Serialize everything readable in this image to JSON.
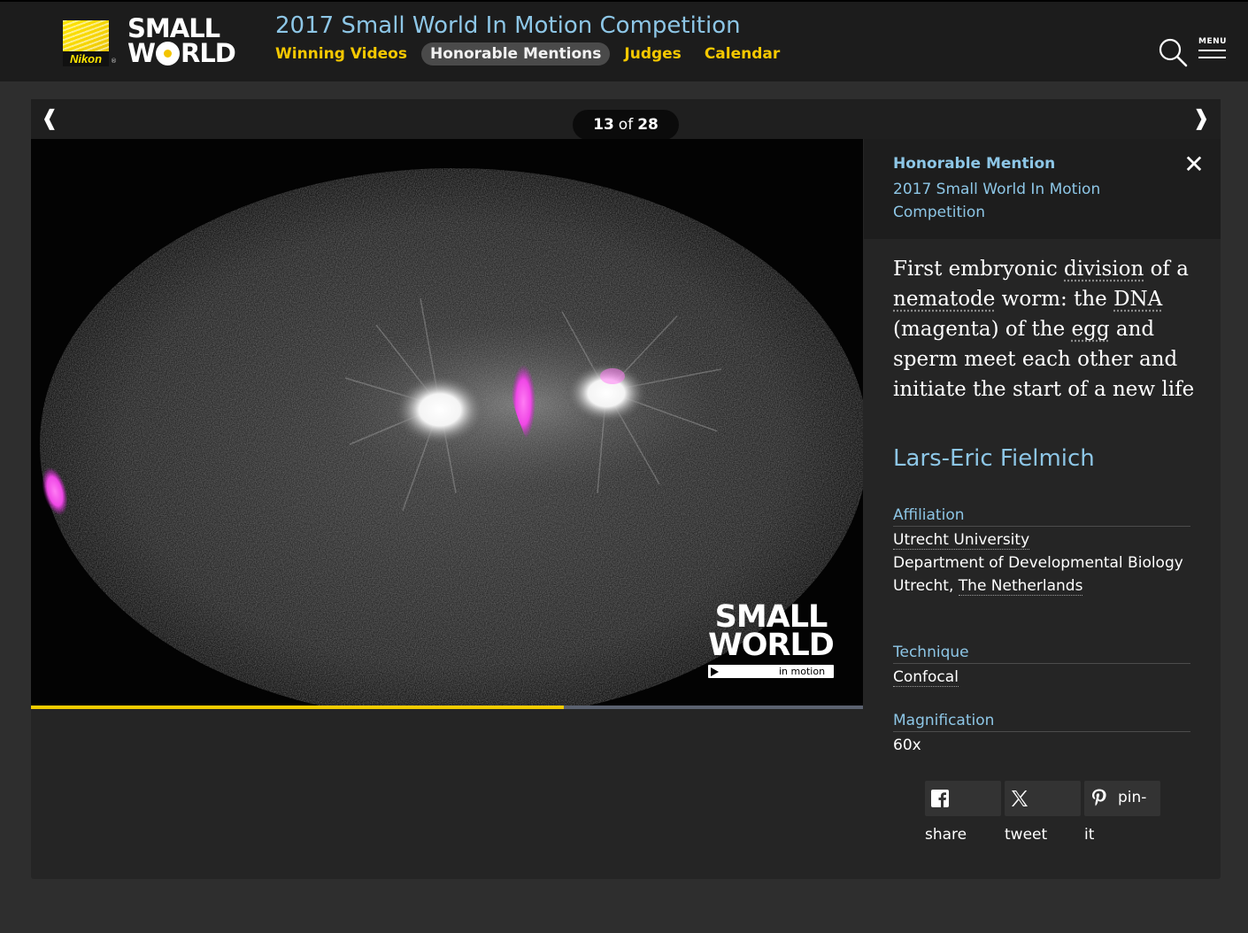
{
  "brand": {
    "nikon_text": "Nikon",
    "registered": "®",
    "small_world_line1": "SMALL",
    "small_world_line2_pre": "W",
    "small_world_line2_post": "RLD"
  },
  "header": {
    "title": "2017 Small World In Motion Competition",
    "nav": [
      {
        "label": "Winning Videos",
        "active": false
      },
      {
        "label": "Honorable Mentions",
        "active": true
      },
      {
        "label": "Judges",
        "active": false
      },
      {
        "label": "Calendar",
        "active": false
      }
    ],
    "search_icon": "search-icon",
    "menu_label": "MENU"
  },
  "gallery": {
    "prev_arrow": "❰",
    "next_arrow": "❱",
    "current": "13",
    "of_text": "of",
    "total": "28",
    "progress_fraction": 0.64,
    "watermark": {
      "line1": "SMALL",
      "line2": "WORLD",
      "tagline": "in motion"
    }
  },
  "info": {
    "award": "Honorable Mention",
    "competition": "2017 Small World In Motion Competition",
    "close_icon": "✕",
    "caption": {
      "p1": "First embryonic ",
      "u1": "division",
      "p2": " of a ",
      "u2": "nematode",
      "p3": " worm: the ",
      "u3": "DNA",
      "p4": " (magenta) of the ",
      "u4": "egg",
      "p5": " and sperm meet each other and initiate the start of a new life"
    },
    "author": "Lars-Eric Fielmich",
    "affiliation": {
      "heading": "Affiliation",
      "university": "Utrecht University",
      "department": "Department of Developmental Biology",
      "city": "Utrecht, ",
      "country": "The Netherlands"
    },
    "technique": {
      "heading": "Technique",
      "value": "Confocal"
    },
    "magnification": {
      "heading": "Magnification",
      "value": "60x"
    },
    "share": [
      {
        "label": "share",
        "icon": "facebook-icon"
      },
      {
        "label": "tweet",
        "icon": "x-twitter-icon"
      },
      {
        "label": "it",
        "inline": "pin-",
        "icon": "pinterest-icon"
      }
    ]
  },
  "colors": {
    "accent_blue": "#8dc6e6",
    "nav_yellow": "#f5c800",
    "progress_yellow": "#f2cc00",
    "dna_magenta": "#ff5cf0"
  }
}
